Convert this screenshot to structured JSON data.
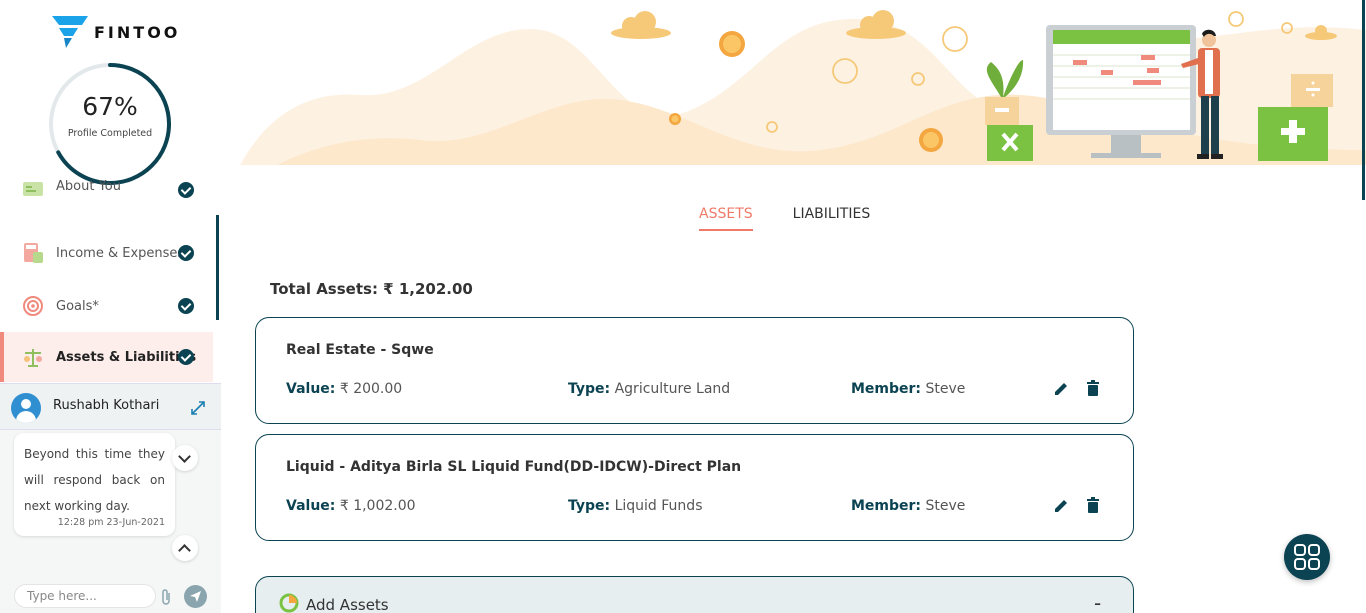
{
  "brand": {
    "name": "FINTOO"
  },
  "profile": {
    "percent": 67,
    "percent_label": "67%",
    "caption": "Profile Completed"
  },
  "nav": {
    "items": [
      {
        "label": "About You",
        "done": true,
        "active": false
      },
      {
        "label": "Income & Expenses*",
        "done": true,
        "active": false
      },
      {
        "label": "Goals*",
        "done": true,
        "active": false
      },
      {
        "label": "Assets & Liabilities",
        "done": true,
        "active": true
      }
    ]
  },
  "chat": {
    "name": "Rushabh Kothari",
    "message": "Beyond this time they will respond back on next working day.",
    "timestamp": "12:28 pm 23-Jun-2021",
    "input_placeholder": "Type here..."
  },
  "tabs": [
    {
      "label": "ASSETS",
      "active": true
    },
    {
      "label": "LIABILITIES",
      "active": false
    }
  ],
  "total_assets": "Total Assets: ₹ 1,202.00",
  "assets": [
    {
      "title": "Real Estate - Sqwe",
      "value_label": "Value:",
      "value": "₹ 200.00",
      "type_label": "Type:",
      "type": "Agriculture Land",
      "member_label": "Member:",
      "member": "Steve"
    },
    {
      "title": "Liquid - Aditya Birla SL Liquid Fund(DD-IDCW)-Direct Plan",
      "value_label": "Value:",
      "value": "₹ 1,002.00",
      "type_label": "Type:",
      "type": "Liquid Funds",
      "member_label": "Member:",
      "member": "Steve"
    }
  ],
  "add_assets": {
    "label": "Add Assets",
    "toggle": "-"
  },
  "colors": {
    "primary": "#0b4352",
    "accent": "#ef7a68",
    "active_bg": "#fdeeec"
  }
}
